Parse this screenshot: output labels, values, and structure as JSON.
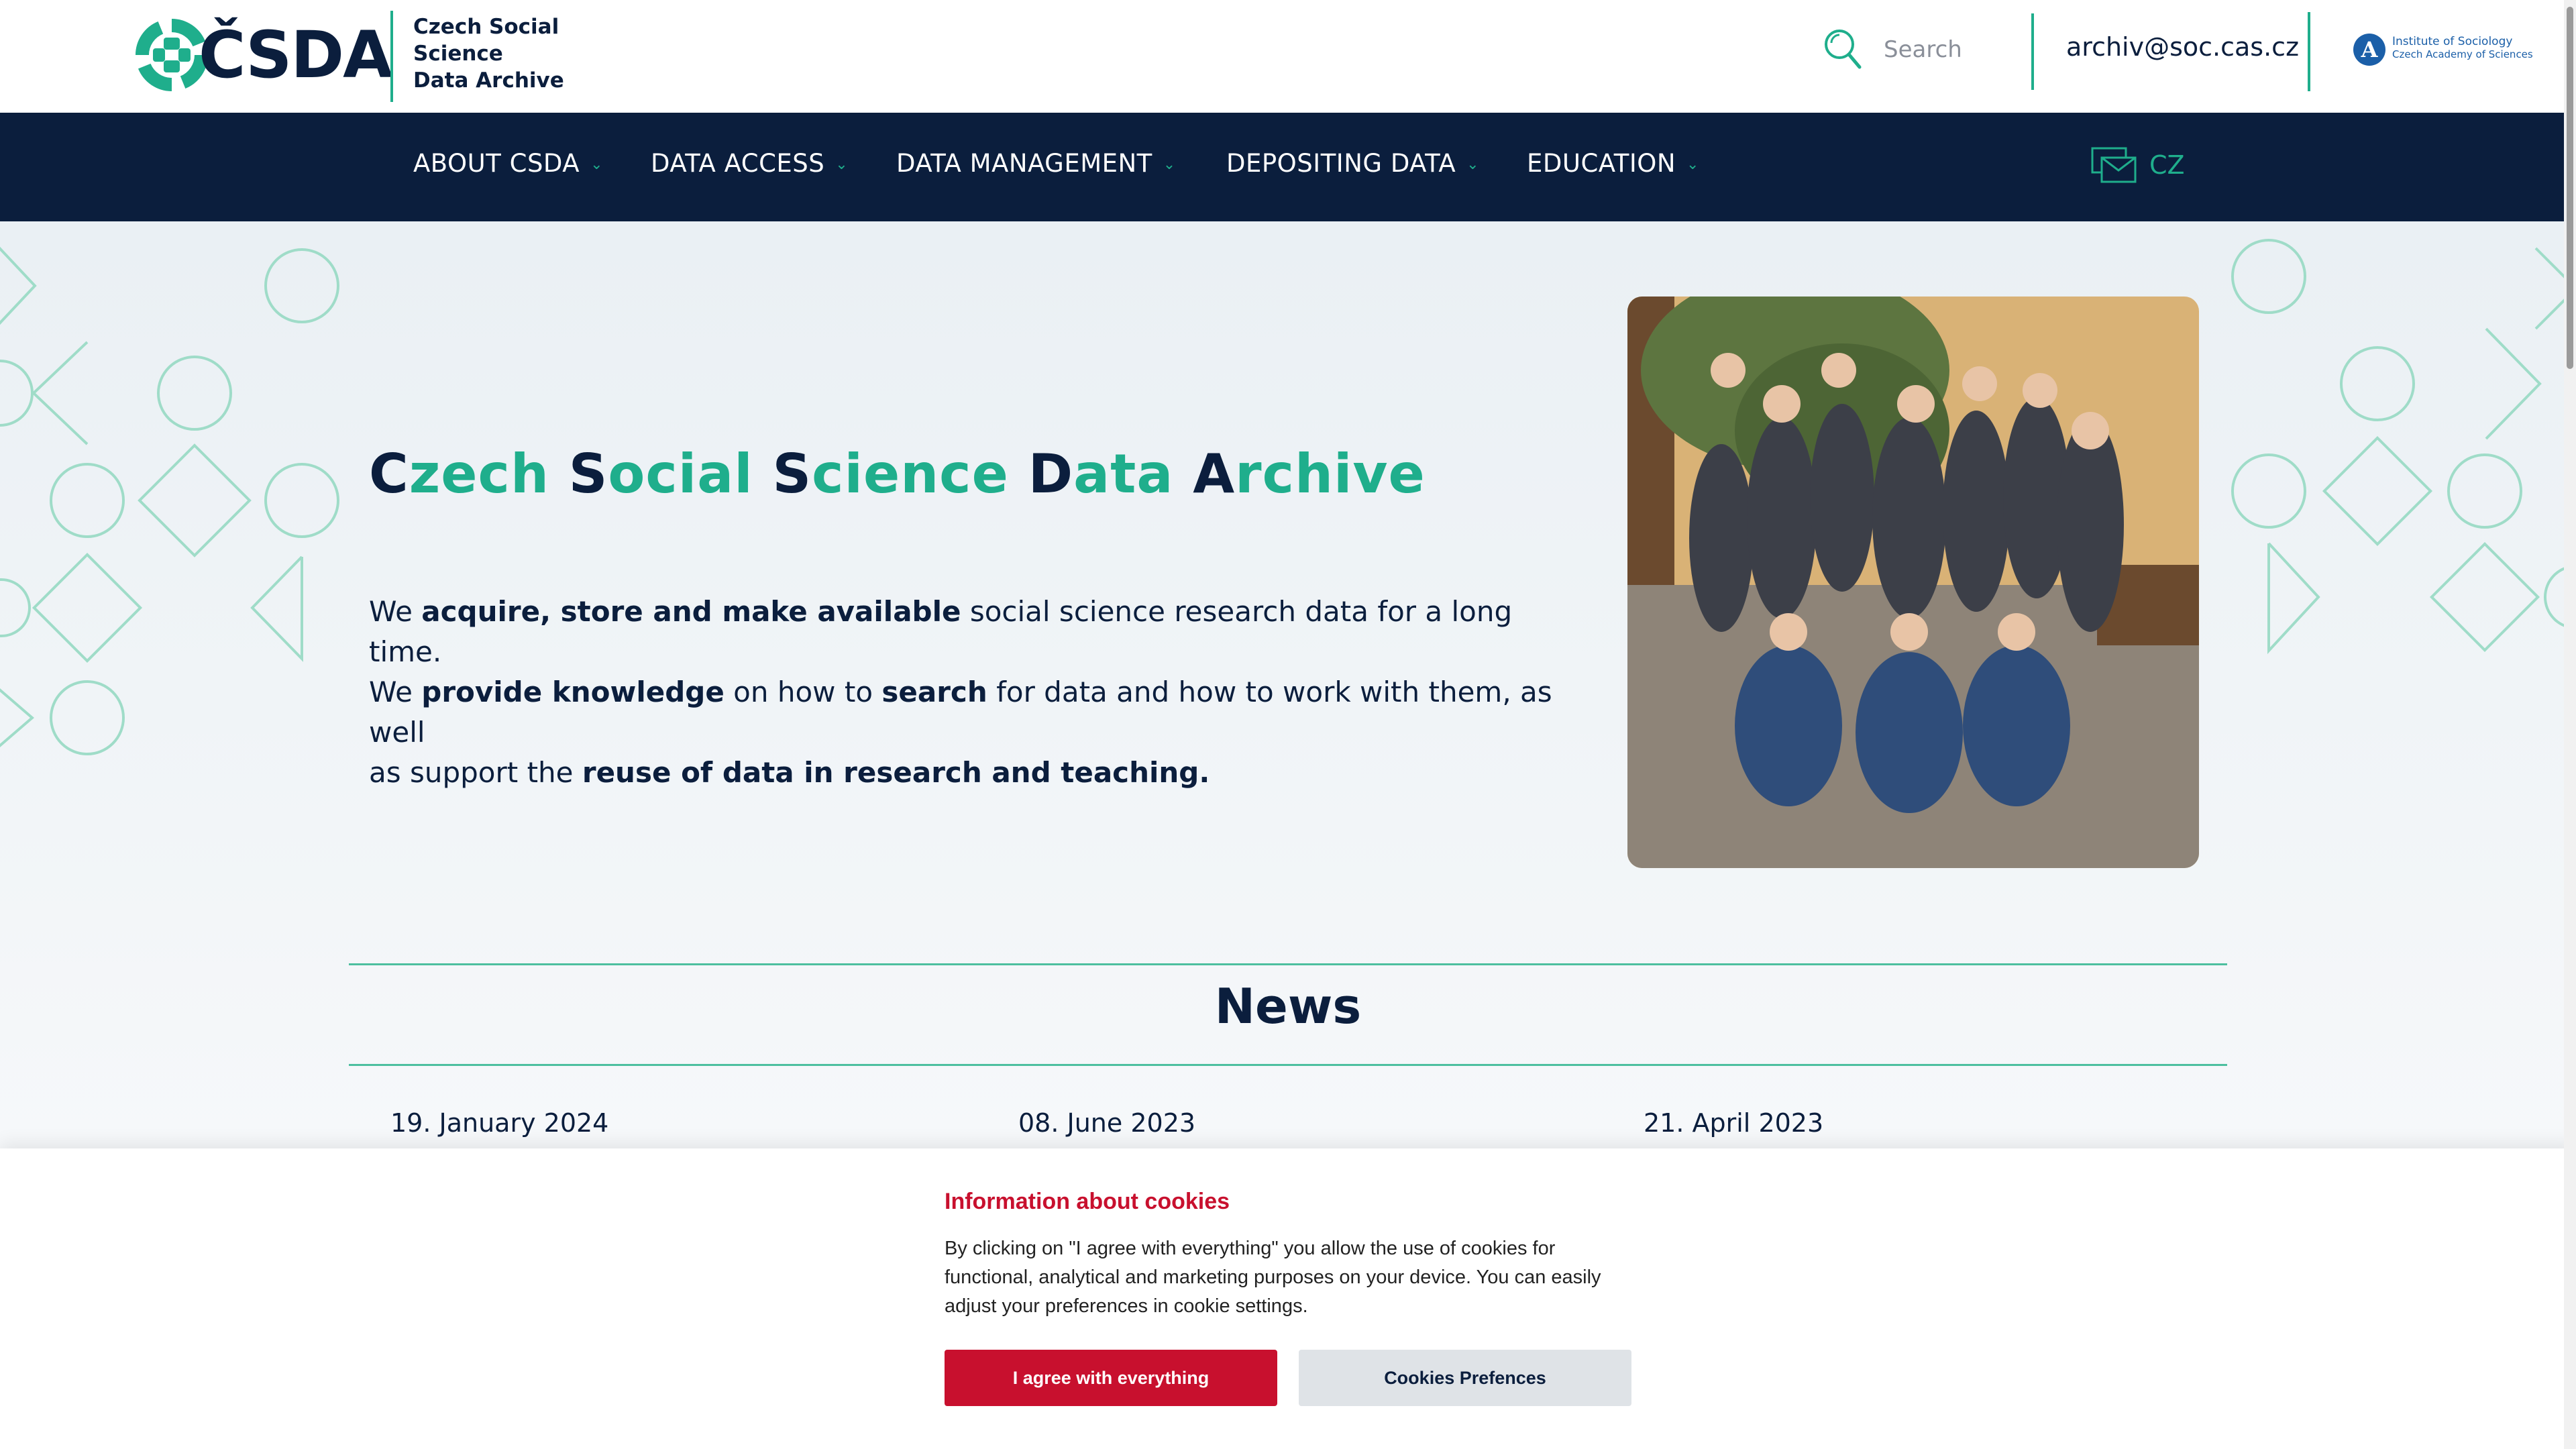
{
  "header": {
    "logo_text": "ČSDA",
    "logo_subtitle": [
      "Czech Social",
      "Science",
      "Data Archive"
    ],
    "search_placeholder": "Search",
    "email": "archiv@soc.cas.cz",
    "institute": {
      "line1": "Institute of Sociology",
      "line2": "Czech Academy of Sciences"
    }
  },
  "nav": {
    "items": [
      {
        "label": "ABOUT CSDA"
      },
      {
        "label": "DATA ACCESS"
      },
      {
        "label": "DATA MANAGEMENT"
      },
      {
        "label": "DEPOSITING DATA"
      },
      {
        "label": "EDUCATION"
      }
    ],
    "chevron": "⌄",
    "language": "CZ"
  },
  "hero": {
    "title_words": [
      {
        "cap": "C",
        "rest": "zech"
      },
      {
        "cap": "S",
        "rest": "ocial"
      },
      {
        "cap": "S",
        "rest": "cience"
      },
      {
        "cap": "D",
        "rest": "ata"
      },
      {
        "cap": "A",
        "rest": "rchive"
      }
    ],
    "text": {
      "p1_a": "We ",
      "p1_b": "acquire, store and make available",
      "p1_c": " social science research data for a long time.",
      "p2_a": "We ",
      "p2_b": "provide knowledge",
      "p2_c": " on how to ",
      "p2_d": "search",
      "p2_e": " for data and how to work with them, as well",
      "p3_a": "as support the ",
      "p3_b": "reuse of data in research and teaching."
    }
  },
  "news": {
    "title": "News",
    "dates": [
      "19. January 2024",
      "08. June 2023",
      "21. April 2023"
    ]
  },
  "cookies": {
    "title": "Information about cookies",
    "text": "By clicking on \"I agree with everything\" you allow the use of cookies for functional, analytical and marketing purposes on your device. You can easily adjust your preferences in cookie settings.",
    "agree_label": "I agree with everything",
    "prefs_label": "Cookies Prefences"
  },
  "colors": {
    "navy": "#0b1e3d",
    "teal": "#1fae8c",
    "cookie_red": "#c8102e"
  }
}
